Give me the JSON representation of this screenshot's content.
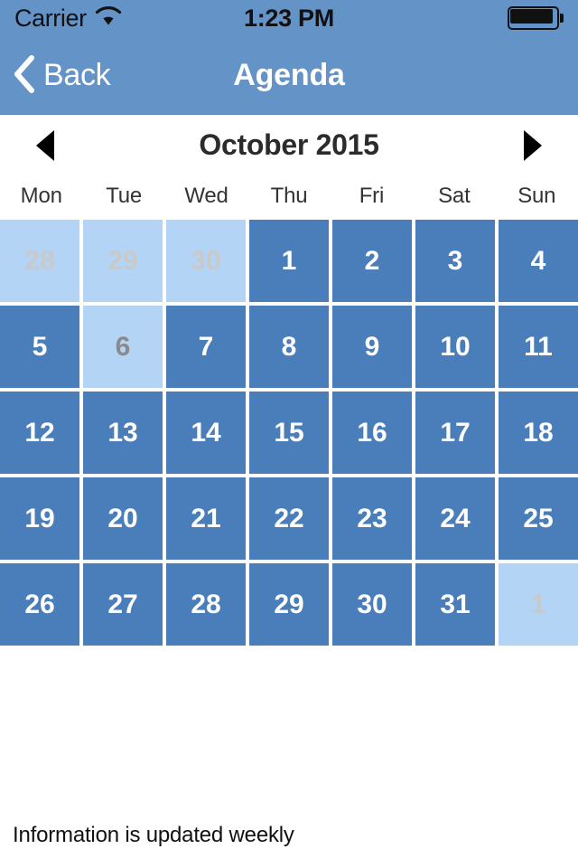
{
  "status_bar": {
    "carrier": "Carrier",
    "wifi_icon": "wifi-icon",
    "time": "1:23 PM",
    "battery_icon": "battery-full-icon"
  },
  "nav_bar": {
    "back_label": "Back",
    "back_icon": "chevron-left-icon",
    "title": "Agenda"
  },
  "month_header": {
    "prev_icon": "triangle-left-icon",
    "next_icon": "triangle-right-icon",
    "title": "October 2015"
  },
  "weekdays": [
    "Mon",
    "Tue",
    "Wed",
    "Thu",
    "Fri",
    "Sat",
    "Sun"
  ],
  "calendar": {
    "month": "October",
    "year": "2015",
    "first_weekday": "Mon",
    "days": [
      {
        "label": "28",
        "state": "out-month"
      },
      {
        "label": "29",
        "state": "out-month"
      },
      {
        "label": "30",
        "state": "out-month"
      },
      {
        "label": "1",
        "state": "in-month"
      },
      {
        "label": "2",
        "state": "in-month"
      },
      {
        "label": "3",
        "state": "in-month"
      },
      {
        "label": "4",
        "state": "in-month"
      },
      {
        "label": "5",
        "state": "in-month"
      },
      {
        "label": "6",
        "state": "selected"
      },
      {
        "label": "7",
        "state": "in-month"
      },
      {
        "label": "8",
        "state": "in-month"
      },
      {
        "label": "9",
        "state": "in-month"
      },
      {
        "label": "10",
        "state": "in-month"
      },
      {
        "label": "11",
        "state": "in-month"
      },
      {
        "label": "12",
        "state": "in-month"
      },
      {
        "label": "13",
        "state": "in-month"
      },
      {
        "label": "14",
        "state": "in-month"
      },
      {
        "label": "15",
        "state": "in-month"
      },
      {
        "label": "16",
        "state": "in-month"
      },
      {
        "label": "17",
        "state": "in-month"
      },
      {
        "label": "18",
        "state": "in-month"
      },
      {
        "label": "19",
        "state": "in-month"
      },
      {
        "label": "20",
        "state": "in-month"
      },
      {
        "label": "21",
        "state": "in-month"
      },
      {
        "label": "22",
        "state": "in-month"
      },
      {
        "label": "23",
        "state": "in-month"
      },
      {
        "label": "24",
        "state": "in-month"
      },
      {
        "label": "25",
        "state": "in-month"
      },
      {
        "label": "26",
        "state": "in-month"
      },
      {
        "label": "27",
        "state": "in-month"
      },
      {
        "label": "28",
        "state": "in-month"
      },
      {
        "label": "29",
        "state": "in-month"
      },
      {
        "label": "30",
        "state": "in-month"
      },
      {
        "label": "31",
        "state": "in-month"
      },
      {
        "label": "1",
        "state": "out-month"
      }
    ]
  },
  "footer": {
    "note": "Information is updated weekly"
  },
  "colors": {
    "nav_blue": "#6493c8",
    "day_blue": "#4a7ebb",
    "day_light_blue": "#b3d4f5",
    "out_month_text": "#c9c9c9",
    "selected_text": "#8a8a8a",
    "in_month_text": "#ffffff",
    "month_title_text": "#2b2b2b",
    "page_background": "#ffffff"
  }
}
